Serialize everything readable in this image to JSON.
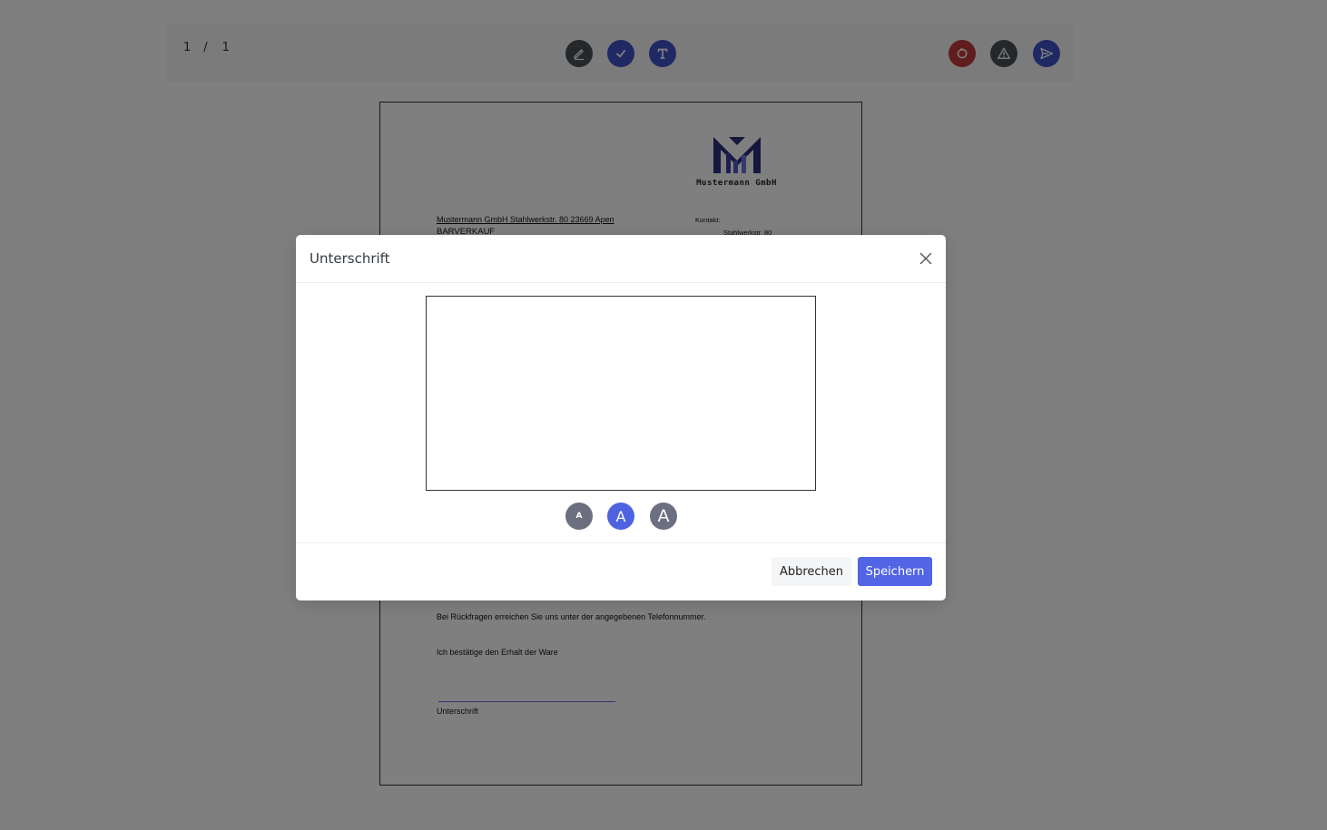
{
  "toolbar": {
    "pager": {
      "current": "1",
      "separator": "/",
      "total": "1"
    },
    "buttons": [
      {
        "name": "pen-icon",
        "color": "#495057"
      },
      {
        "name": "check-icon",
        "color": "#4053c9"
      },
      {
        "name": "text-icon",
        "color": "#4053c9"
      },
      {
        "name": "reset-icon",
        "color": "#c03a3a"
      },
      {
        "name": "warning-icon",
        "color": "#495057"
      },
      {
        "name": "send-icon",
        "color": "#4053c9"
      }
    ]
  },
  "document": {
    "logo_text": "Mustermann GmbH",
    "sender_line": "Mustermann GmbH Stahlwerkstr. 80 23669 Apen",
    "recipient": "BARVERKAUF",
    "kontakt_label": "Kontakt:",
    "kontakt_street": "Stahlwerkstr. 80",
    "questions_text": "Bei Rückfragen erreichen Sie uns unter der angegebenen Telefonnummer.",
    "confirm_text": "Ich bestätige den Erhalt der Ware",
    "signature_label": "Unterschrift"
  },
  "modal": {
    "title": "Unterschrift",
    "size_buttons": [
      {
        "label": "A",
        "size": "small",
        "color": "#6c6f80"
      },
      {
        "label": "A",
        "size": "medium",
        "color": "#4e63e0"
      },
      {
        "label": "A",
        "size": "large",
        "color": "#6c6f80"
      }
    ],
    "cancel_label": "Abbrechen",
    "save_label": "Speichern"
  },
  "colors": {
    "backdrop": "rgba(0,0,0,0.5)",
    "primary": "#5165e6",
    "danger": "#c03a3a",
    "dark": "#495057"
  }
}
